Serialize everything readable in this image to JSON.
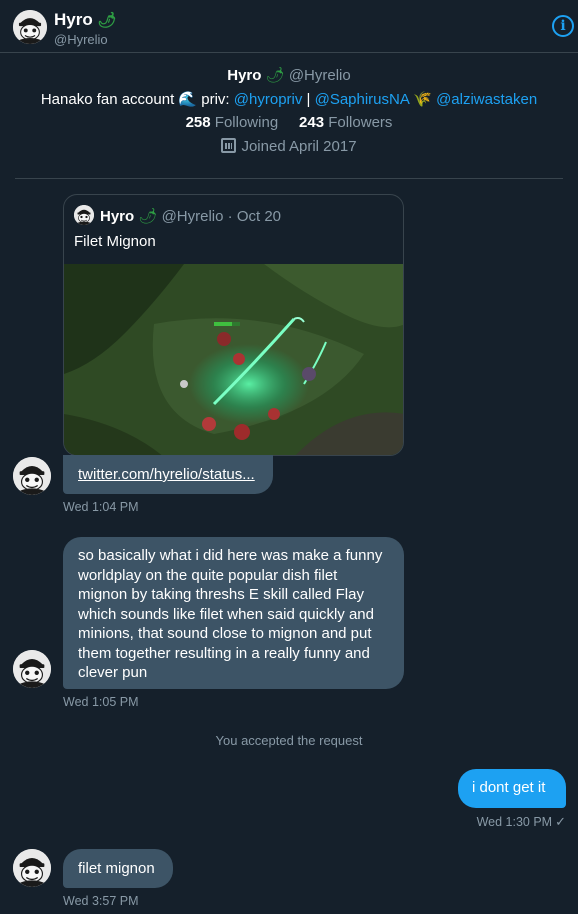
{
  "header": {
    "name": "Hyro",
    "name_emoji": "🌶",
    "handle": "@Hyrelio",
    "info_icon": "info-icon"
  },
  "profile": {
    "name": "Hyro",
    "name_emoji": "🌶",
    "handle": "@Hyrelio",
    "bio_prefix": "Hanako fan account 🌊 priv: ",
    "bio_link1": "@hyropriv",
    "bio_sep": " | ",
    "bio_link2": "@SaphirusNA",
    "bio_emoji": " 🌾 ",
    "bio_link3": "@alziwastaken",
    "following_count": "258",
    "following_label": "Following",
    "followers_count": "243",
    "followers_label": "Followers",
    "joined": "Joined April 2017"
  },
  "quoted_tweet": {
    "name": "Hyro",
    "name_emoji": "🌶",
    "handle": "@Hyrelio",
    "date": "· Oct 20",
    "text": "Filet Mignon",
    "image": "league-of-legends-gameplay-screenshot"
  },
  "messages": [
    {
      "link": "twitter.com/hyrelio/status...",
      "time": "Wed 1:04 PM"
    },
    {
      "text": "so basically what i did here was make a funny worldplay on the quite popular dish filet mignon by taking threshs E skill called Flay which sounds like filet when said quickly and minions, that sound close to mignon and put them together resulting in a really funny and clever pun",
      "time": "Wed 1:05 PM"
    },
    {
      "system": "You accepted the request"
    },
    {
      "text": "i dont get it",
      "time": "Wed 1:30 PM",
      "status": "✓"
    },
    {
      "text": "filet mignon",
      "time": "Wed 3:57 PM"
    }
  ],
  "colors": {
    "background": "#15202b",
    "accent": "#1da1f2",
    "incoming_bubble": "#3d5466",
    "muted_text": "#8899a6",
    "divider": "#38444d"
  }
}
